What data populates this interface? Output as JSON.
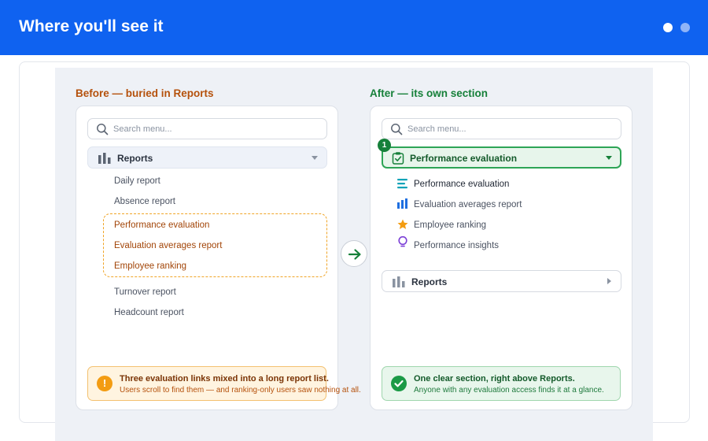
{
  "header": {
    "title": "Where you'll see it",
    "pager": {
      "total": 2,
      "active": 1
    }
  },
  "before": {
    "title": "Before — buried in Reports",
    "search_placeholder": "Search menu...",
    "section_label": "Reports",
    "items": [
      "Daily report",
      "Absence report"
    ],
    "highlighted_items": [
      "Performance evaluation",
      "Evaluation averages report",
      "Employee ranking"
    ],
    "items_after": [
      "Turnover report",
      "Headcount report"
    ],
    "note": {
      "heading": "Three evaluation links mixed into a long report list.",
      "sub": "Users scroll to find them — and ranking-only users saw nothing at all."
    }
  },
  "after": {
    "title": "After — its own section",
    "search_placeholder": "Search menu...",
    "badge": "1",
    "section_label": "Performance evaluation",
    "items": [
      {
        "label": "Performance evaluation",
        "icon": "lines-icon"
      },
      {
        "label": "Evaluation averages report",
        "icon": "bar-chart-icon"
      },
      {
        "label": "Employee ranking",
        "icon": "star-icon"
      },
      {
        "label": "Performance insights",
        "icon": "lightbulb-icon"
      }
    ],
    "collapsed_section": "Reports",
    "note": {
      "heading": "One clear section, right above Reports.",
      "sub": "Anyone with any evaluation access finds it at a glance."
    }
  },
  "colors": {
    "header": "#0f62f0",
    "before_accent": "#b5510c",
    "after_accent": "#16803a",
    "highlight_border": "#f0a426"
  }
}
